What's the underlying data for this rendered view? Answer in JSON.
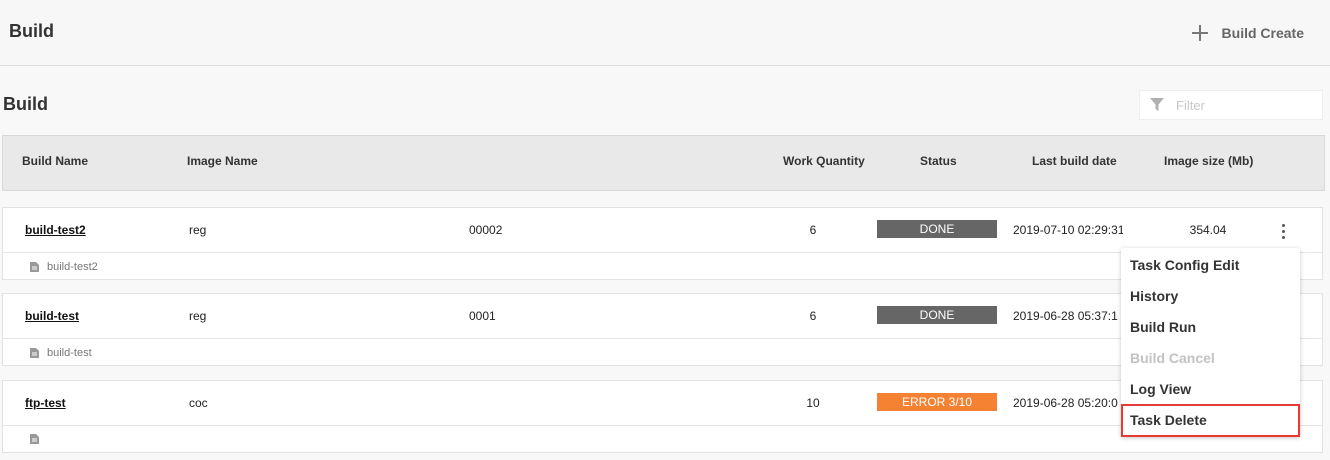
{
  "header": {
    "title": "Build",
    "create_label": "Build Create"
  },
  "section": {
    "title": "Build",
    "filter_placeholder": "Filter"
  },
  "table": {
    "columns": [
      "Build Name",
      "Image Name",
      "Work Quantity",
      "Status",
      "Last build date",
      "Image size (Mb)"
    ],
    "rows": [
      {
        "name": "build-test2",
        "image": "reg",
        "tag": "00002",
        "quantity": "6",
        "status": "DONE",
        "status_color": "#666666",
        "date": "2019-07-10 02:29:31",
        "size": "354.04",
        "sub": "build-test2"
      },
      {
        "name": "build-test",
        "image": "reg",
        "tag": "0001",
        "quantity": "6",
        "status": "DONE",
        "status_color": "#666666",
        "date": "2019-06-28 05:37:1",
        "size": "",
        "sub": "build-test"
      },
      {
        "name": "ftp-test",
        "image": "coc",
        "tag": "",
        "quantity": "10",
        "status": "ERROR 3/10",
        "status_color": "#f58233",
        "date": "2019-06-28 05:20:0",
        "size": "",
        "sub": ""
      }
    ]
  },
  "context_menu": {
    "items": [
      {
        "label": "Task Config Edit",
        "disabled": false
      },
      {
        "label": "History",
        "disabled": false
      },
      {
        "label": "Build Run",
        "disabled": false
      },
      {
        "label": "Build Cancel",
        "disabled": true
      },
      {
        "label": "Log View",
        "disabled": false
      },
      {
        "label": "Task Delete",
        "disabled": false,
        "highlighted": true
      }
    ]
  }
}
